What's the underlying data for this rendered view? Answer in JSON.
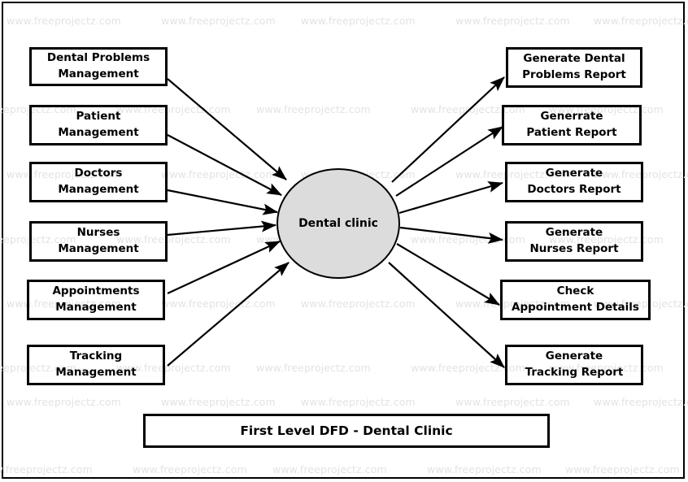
{
  "diagram": {
    "title": "First Level DFD - Dental Clinic",
    "watermark_text": "www.freeprojectz.com",
    "process": {
      "label": "Dental clinic",
      "fill_color": "#dcdcdc",
      "stroke_color": "#000000"
    },
    "inputs": [
      {
        "label": "Dental Problems\nManagement",
        "line1": "Dental Problems",
        "line2": "Management"
      },
      {
        "label": "Patient\nManagement",
        "line1": "Patient",
        "line2": "Management"
      },
      {
        "label": "Doctors\nManagement",
        "line1": "Doctors",
        "line2": "Management"
      },
      {
        "label": "Nurses\nManagement",
        "line1": "Nurses",
        "line2": "Management"
      },
      {
        "label": "Appointments\nManagement",
        "line1": "Appointments",
        "line2": "Management"
      },
      {
        "label": "Tracking\nManagement",
        "line1": "Tracking",
        "line2": "Management"
      }
    ],
    "outputs": [
      {
        "label": "Generate Dental\nProblems Report",
        "line1": "Generate Dental",
        "line2": "Problems Report"
      },
      {
        "label": "Generrate\nPatient Report",
        "line1": "Generrate",
        "line2": "Patient Report"
      },
      {
        "label": "Generate\nDoctors Report",
        "line1": "Generate",
        "line2": "Doctors Report"
      },
      {
        "label": "Generate\nNurses Report",
        "line1": "Generate",
        "line2": "Nurses Report"
      },
      {
        "label": "Check\nAppointment Details",
        "line1": "Check",
        "line2": "Appointment Details"
      },
      {
        "label": "Generate\nTracking Report",
        "line1": "Generate",
        "line2": "Tracking Report"
      }
    ]
  }
}
